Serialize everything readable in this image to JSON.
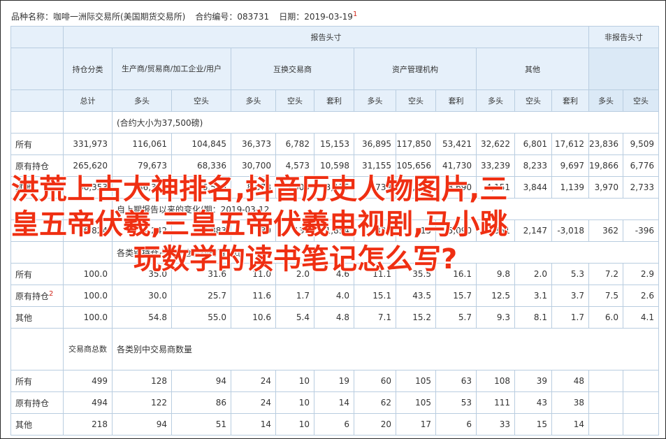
{
  "header": {
    "product": "品种名称：咖啡一洲际交易所(美国期货交易所)",
    "contract_code": "合约编号：083731",
    "date": "日期：2019-03-19",
    "date_note": "1"
  },
  "table": {
    "report_group": "报告头寸",
    "nonreport_group": "非报告头寸",
    "holding_category": "持仓分类",
    "cat_producer": "生产商/贸易商/加工企业/用户",
    "cat_swap": "互换交易商",
    "cat_money": "资产管理机构",
    "cat_other": "其他",
    "total": "总计",
    "long": "多头",
    "short": "空头",
    "spread": "套利",
    "contract_size": "(合约大小为37,500磅)",
    "change_title": "自上期报告以来的变化(期：2019-03-12",
    "pct_title": "各类别持仓占未平仓合约的百分比",
    "traders_label": "交易商总数",
    "traders_title": "各类别中交易商数量",
    "rows_oi": [
      {
        "label": "所有",
        "vals": [
          "331,973",
          "116,061",
          "104,845",
          "36,373",
          "6,782",
          "15,153",
          "36,895",
          "117,850",
          "53,421",
          "32,622",
          "6,801",
          "17,612",
          "23,836",
          "9,509"
        ]
      },
      {
        "label": "原有持仓",
        "vals": [
          "265,620",
          "79,673",
          "68,336",
          "30,700",
          "4,573",
          "10,598",
          "31,155",
          "105,656",
          "41,730",
          "33,239",
          "8,233",
          "9,697",
          "19,866",
          "6,776"
        ]
      },
      {
        "label": "其他",
        "vals": [
          "66,353",
          "36,388",
          "36,509",
          "8,073",
          "3,509",
          "3,175",
          "4,739",
          "15,198",
          "8,690",
          "4,151",
          "3,844",
          "1,139",
          "3,970",
          "2,733"
        ]
      }
    ],
    "row_change": {
      "label": "",
      "vals": [
        "6,824",
        "1,242",
        "2,883",
        "39",
        "136",
        "1,854",
        "338",
        "15",
        "5,090",
        "351",
        "2,147",
        "-3,018",
        "362",
        "-396"
      ]
    },
    "rows_pct": [
      {
        "label": "所有",
        "sup": "",
        "vals": [
          "100.0",
          "35.0",
          "31.6",
          "11.0",
          "2.0",
          "4.6",
          "11.1",
          "35.5",
          "16.1",
          "9.8",
          "2.0",
          "5.3",
          "7.2",
          "2.9"
        ]
      },
      {
        "label": "原有持仓",
        "sup": "2",
        "vals": [
          "100.0",
          "30.0",
          "25.7",
          "11.6",
          "1.7",
          "4.0",
          "15.1",
          "43.5",
          "15.7",
          "12.5",
          "3.1",
          "3.7",
          "7.5",
          "2.6"
        ]
      },
      {
        "label": "其他",
        "sup": "",
        "vals": [
          "100.0",
          "54.8",
          "55.0",
          "10.6",
          "5.4",
          "4.8",
          "7.1",
          "15.2",
          "5.7",
          "9.3",
          "8.1",
          "1.7",
          "6.0",
          "4.1"
        ]
      }
    ],
    "rows_traders": [
      {
        "label": "所有",
        "vals": [
          "499",
          "128",
          "94",
          "24",
          "10",
          "19",
          "60",
          "105",
          "63",
          "108",
          "39",
          "48",
          "",
          ""
        ]
      },
      {
        "label": "原有持仓",
        "vals": [
          "494",
          "122",
          "86",
          "24",
          "10",
          "14",
          "62",
          "105",
          "53",
          "111",
          "43",
          "38",
          "",
          ""
        ]
      },
      {
        "label": "其他",
        "vals": [
          "218",
          "94",
          "51",
          "14",
          "10",
          "6",
          "20",
          "17",
          "6",
          "33",
          "15",
          "14",
          "",
          ""
        ]
      }
    ]
  },
  "overlay": {
    "line1": "洪荒上古大神排名,抖音历史人物图片,三",
    "line2": "皇五帝伏羲,三皇五帝伏羲电视剧,马小跳",
    "line3": "玩数学的读书笔记怎么写?"
  }
}
